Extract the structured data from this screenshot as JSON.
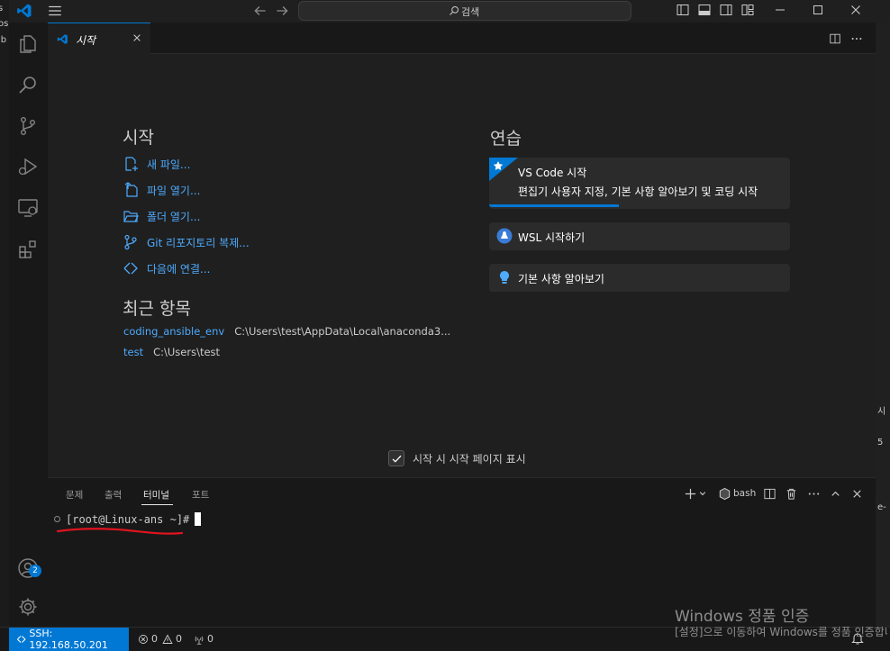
{
  "title_bar": {
    "search_label": "검색"
  },
  "editor_tab": {
    "label": "시작"
  },
  "start": {
    "heading": "시작",
    "links": [
      {
        "label": "새 파일...",
        "icon": "new-file-icon"
      },
      {
        "label": "파일 열기...",
        "icon": "open-file-icon"
      },
      {
        "label": "폴더 열기...",
        "icon": "open-folder-icon"
      },
      {
        "label": "Git 리포지토리 복제...",
        "icon": "source-control-icon"
      },
      {
        "label": "다음에 연결...",
        "icon": "remote-icon"
      }
    ]
  },
  "recent": {
    "heading": "최근 항목",
    "items": [
      {
        "name": "coding_ansible_env",
        "path": "C:\\Users\\test\\AppData\\Local\\anaconda3..."
      },
      {
        "name": "test",
        "path": "C:\\Users\\test"
      }
    ]
  },
  "walkthroughs": {
    "heading": "연습",
    "featured": {
      "title": "VS Code 시작",
      "description": "편집기 사용자 지정, 기본 사항 알아보기 및 코딩 시작",
      "progress": 0.43
    },
    "items": [
      {
        "title": "WSL 시작하기",
        "icon": "linux-icon"
      },
      {
        "title": "기본 사항 알아보기",
        "icon": "lightbulb-icon"
      }
    ]
  },
  "show_on_startup": {
    "label": "시작 시 시작 페이지 표시",
    "checked": true
  },
  "panel": {
    "tabs": [
      "문제",
      "출력",
      "터미널",
      "포트"
    ],
    "active_tab": "터미널",
    "shell_label": "bash",
    "prompt": "[root@Linux-ans ~]#"
  },
  "accounts_badge": "2",
  "status_bar": {
    "remote": "SSH: 192.168.50.201",
    "errors": "0",
    "warnings": "0",
    "ports": "0"
  },
  "side_fragments": {
    "left": [
      "s",
      "os",
      "ib"
    ],
    "right": [
      "시",
      "5",
      "e-"
    ]
  },
  "watermark": {
    "title": "Windows 정품 인증",
    "subtitle": "[설정]으로 이동하여 Windows를 정품 인증합니다."
  },
  "colors": {
    "accent": "#0078d4",
    "link": "#4daafc",
    "annotation_red": "#e0141e"
  }
}
